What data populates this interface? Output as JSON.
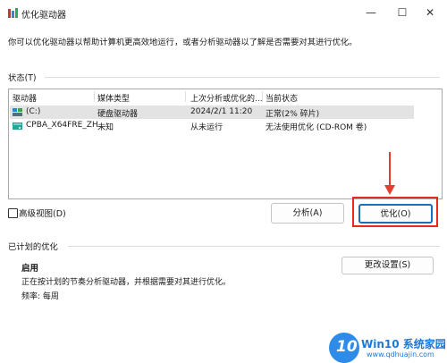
{
  "window": {
    "title": "优化驱动器",
    "minimize": "—",
    "maximize": "☐",
    "close": "✕"
  },
  "description": "你可以优化驱动器以帮助计算机更高效地运行，或者分析驱动器以了解是否需要对其进行优化。",
  "status_section": {
    "label": "状态(T)"
  },
  "drive_list": {
    "columns": [
      "驱动器",
      "媒体类型",
      "上次分析或优化的...",
      "当前状态"
    ],
    "rows": [
      {
        "drive": "(C:)",
        "media_type": "硬盘驱动器",
        "last_run": "2024/2/1 11:20",
        "status": "正常(2% 碎片)",
        "icon": "hdd-icon",
        "selected": true
      },
      {
        "drive": "CPBA_X64FRE_ZH...",
        "media_type": "未知",
        "last_run": "从未运行",
        "status": "无法使用优化 (CD-ROM 卷)",
        "icon": "cdrom-icon",
        "selected": false
      }
    ]
  },
  "advanced_view": {
    "label": "高级视图(D)",
    "checked": false
  },
  "buttons": {
    "analyze": "分析(A)",
    "optimize": "优化(O)",
    "change_settings": "更改设置(S)"
  },
  "scheduled": {
    "label": "已计划的优化",
    "state": "启用",
    "detail": "正在按计划的节奏分析驱动器，并根据需要对其进行优化。",
    "frequency": "频率: 每周"
  },
  "annotation": {
    "color": "#e53e2e"
  },
  "watermark": {
    "badge": "10",
    "brand": "Win10 系统家园",
    "url": "www.qdhuajin.com"
  },
  "colors": {
    "accent": "#1a6ebd",
    "selected_row": "#e3e3e3"
  }
}
